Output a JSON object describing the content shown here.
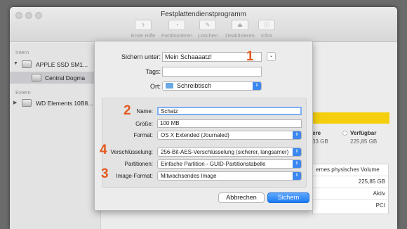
{
  "window": {
    "title": "Festplattendienstprogramm",
    "toolbar": [
      {
        "label": "Erste Hilfe",
        "icon": "stethoscope-icon",
        "glyph": "⚕"
      },
      {
        "label": "Partitionieren",
        "icon": "pie-icon",
        "glyph": "◔"
      },
      {
        "label": "Löschen",
        "icon": "eraser-icon",
        "glyph": "✎"
      },
      {
        "label": "Deaktivieren",
        "icon": "eject-icon",
        "glyph": "⏏"
      },
      {
        "label": "Infos",
        "icon": "info-icon",
        "glyph": "ⓘ"
      }
    ]
  },
  "sidebar": {
    "intern_label": "Intern",
    "extern_label": "Extern",
    "items": [
      {
        "label": "APPLE SSD SM1..."
      },
      {
        "label": "Central Dogma"
      },
      {
        "label": "WD Elements 10B8..."
      }
    ]
  },
  "background": {
    "legend_left": "ere",
    "legend_right": "Verfügbar",
    "size_left": "33 GB",
    "size_right": "225,85 GB",
    "info_header": "ernes physisches Volume",
    "info_rows": [
      "225,85 GB",
      "Aktiv",
      "PCI"
    ]
  },
  "dialog": {
    "save_as_label": "Sichern unter:",
    "save_as_value": "Mein Schaaaatz!",
    "tags_label": "Tags:",
    "tags_value": "",
    "location_label": "Ort:",
    "location_value": "Schreibtisch",
    "name_label": "Name:",
    "name_value": "Schatz",
    "size_label": "Größe:",
    "size_value": "100 MB",
    "format_label": "Format:",
    "format_value": "OS X Extended (Journaled)",
    "encryption_label": "Verschlüsselung:",
    "encryption_value": "256-Bit-AES-Verschlüsselung (sicherer, langsamer)",
    "partitions_label": "Partitionen:",
    "partitions_value": "Einfache Partition - GUID-Partitionstabelle",
    "image_format_label": "Image-Format:",
    "image_format_value": "Mitwachsendes Image",
    "cancel_label": "Abbrechen",
    "save_label": "Sichern"
  },
  "annotations": [
    "1",
    "2",
    "3",
    "4"
  ],
  "colors": {
    "accent": "#1c7bf1",
    "annotation": "#e1591e",
    "usage_bar": "#f5cf0d"
  }
}
